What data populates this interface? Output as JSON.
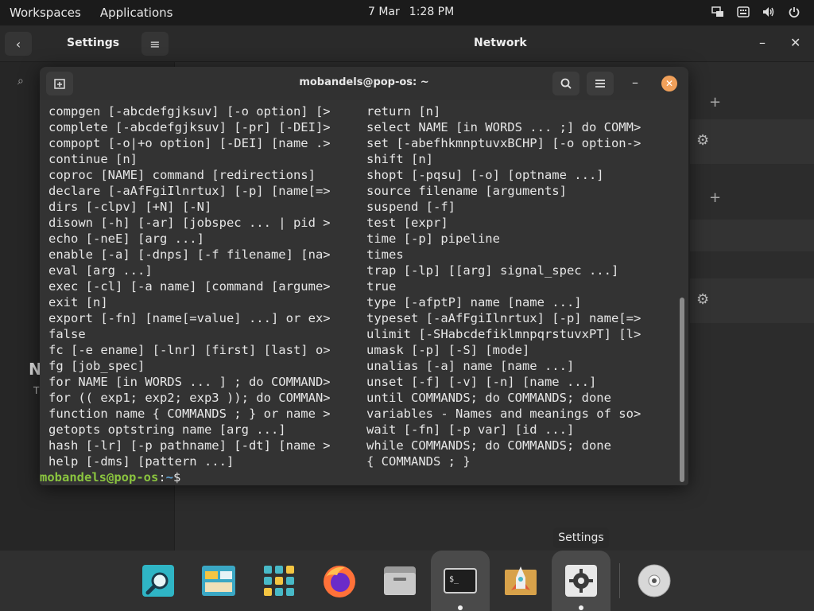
{
  "topbar": {
    "workspaces": "Workspaces",
    "applications": "Applications",
    "date": "7 Mar",
    "time": "1:28 PM"
  },
  "settings": {
    "title": "Settings",
    "panel_title": "Network",
    "search_placeholder": "",
    "left_heading": "N",
    "left_sub": "T"
  },
  "terminal": {
    "title": "mobandels@pop-os: ~",
    "col1": [
      "compgen [-abcdefgjksuv] [-o option] [>",
      "complete [-abcdefgjksuv] [-pr] [-DEI]>",
      "compopt [-o|+o option] [-DEI] [name .>",
      "continue [n]",
      "coproc [NAME] command [redirections]",
      "declare [-aAfFgiIlnrtux] [-p] [name[=>",
      "dirs [-clpv] [+N] [-N]",
      "disown [-h] [-ar] [jobspec ... | pid >",
      "echo [-neE] [arg ...]",
      "enable [-a] [-dnps] [-f filename] [na>",
      "eval [arg ...]",
      "exec [-cl] [-a name] [command [argume>",
      "exit [n]",
      "export [-fn] [name[=value] ...] or ex>",
      "false",
      "fc [-e ename] [-lnr] [first] [last] o>",
      "fg [job_spec]",
      "for NAME [in WORDS ... ] ; do COMMAND>",
      "for (( exp1; exp2; exp3 )); do COMMAN>",
      "function name { COMMANDS ; } or name >",
      "getopts optstring name [arg ...]",
      "hash [-lr] [-p pathname] [-dt] [name >",
      "help [-dms] [pattern ...]"
    ],
    "col2": [
      "return [n]",
      "select NAME [in WORDS ... ;] do COMM>",
      "set [-abefhkmnptuvxBCHP] [-o option->",
      "shift [n]",
      "shopt [-pqsu] [-o] [optname ...]",
      "source filename [arguments]",
      "suspend [-f]",
      "test [expr]",
      "time [-p] pipeline",
      "times",
      "trap [-lp] [[arg] signal_spec ...]",
      "true",
      "type [-afptP] name [name ...]",
      "typeset [-aAfFgiIlnrtux] [-p] name[=>",
      "ulimit [-SHabcdefiklmnpqrstuvxPT] [l>",
      "umask [-p] [-S] [mode]",
      "unalias [-a] name [name ...]",
      "unset [-f] [-v] [-n] [name ...]",
      "until COMMANDS; do COMMANDS; done",
      "variables - Names and meanings of so>",
      "wait [-fn] [-p var] [id ...]",
      "while COMMANDS; do COMMANDS; done",
      "{ COMMANDS ; }"
    ],
    "prompt_user": "mobandels@pop-os",
    "prompt_sep": ":",
    "prompt_path": "~",
    "prompt_symbol": "$"
  },
  "dock": {
    "tooltip": "Settings",
    "items": [
      "search-icon",
      "files-icon",
      "app-grid-icon",
      "firefox-icon",
      "file-manager-icon",
      "terminal-icon",
      "launcher-icon",
      "settings-icon",
      "disc-icon"
    ]
  },
  "colors": {
    "prompt_user": "#8ac43f",
    "prompt_path": "#5fa0d0",
    "close_button": "#f0a05a"
  }
}
